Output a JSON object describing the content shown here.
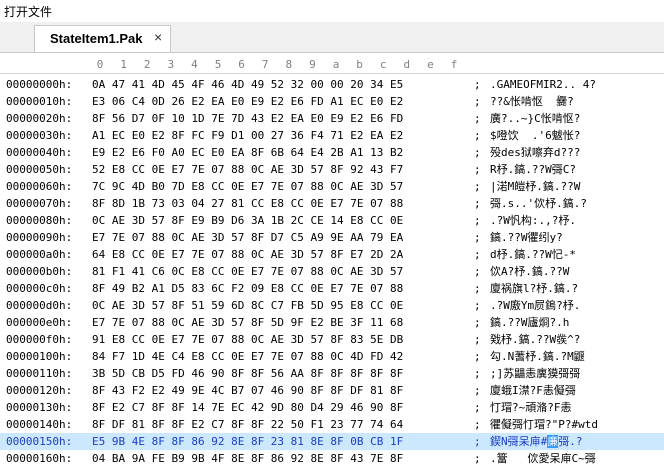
{
  "window": {
    "title": "打开文件"
  },
  "tabs": [
    {
      "label": "StateItem1.Pak",
      "close": "×"
    }
  ],
  "ruler": [
    "0",
    "1",
    "2",
    "3",
    "4",
    "5",
    "6",
    "7",
    "8",
    "9",
    "a",
    "b",
    "c",
    "d",
    "e",
    "f"
  ],
  "rows": [
    {
      "offset": "00000000h:",
      "hex": "0A 47 41 4D 45 4F 46 4D 49 52 32 00 00 20 34 E5",
      "ascii": ".GAMEOFMIR2.. 4?"
    },
    {
      "offset": "00000010h:",
      "hex": "E3 06 C4 0D 26 E2 EA E0 E9 E2 E6 FD A1 EC E0 E2",
      "ascii": "??&怅啃怄  爨?"
    },
    {
      "offset": "00000020h:",
      "hex": "8F 56 D7 0F 10 1D 7E 7D 43 E2 EA E0 E9 E2 E6 FD",
      "ascii": "廣?..~}C怅啃怄?"
    },
    {
      "offset": "00000030h:",
      "hex": "A1 EC E0 E2 8F FC F9 D1 00 27 36 F4 71 E2 EA E2",
      "ascii": "$噔饮  .'6魃怅?"
    },
    {
      "offset": "00000040h:",
      "hex": "E9 E2 E6 F0 A0 EC E0 EA 8F 6B 64 E4 2B A1 13 B2",
      "ascii": "殁des狱嚓弃d???"
    },
    {
      "offset": "00000050h:",
      "hex": "52 E8 CC 0E E7 7E 07 88 0C AE 3D 57 8F 92 43 F7",
      "ascii": "R杼.鎬.??W彁C?"
    },
    {
      "offset": "00000060h:",
      "hex": "7C 9C 4D B0 7D E8 CC 0E E7 7E 07 88 0C AE 3D 57",
      "ascii": "|渃M皚杼.鎬.??W"
    },
    {
      "offset": "00000070h:",
      "hex": "8F 8D 1B 73 03 04 27 81 CC E8 CC 0E E7 7E 07 88",
      "ascii": "彁.s..'佽杼.鎬.?"
    },
    {
      "offset": "00000080h:",
      "hex": "0C AE 3D 57 8F E9 B9 D6 3A 1B 2C CE 14 E8 CC 0E",
      "ascii": ".?W忛构:.,?杼."
    },
    {
      "offset": "00000090h:",
      "hex": "E7 7E 07 88 0C AE 3D 57 8F D7 C5 A9 9E AA 79 EA",
      "ascii": "鎬.??W忂纼y?"
    },
    {
      "offset": "000000a0h:",
      "hex": "64 E8 CC 0E E7 7E 07 88 0C AE 3D 57 8F E7 2D 2A",
      "ascii": "d杼.鎬.??W忋-*"
    },
    {
      "offset": "000000b0h:",
      "hex": "81 F1 41 C6 0C E8 CC 0E E7 7E 07 88 0C AE 3D 57",
      "ascii": "佽A?杼.鎬.??W"
    },
    {
      "offset": "000000c0h:",
      "hex": "8F 49 B2 A1 D5 83 6C F2 09 E8 CC 0E E7 7E 07 88",
      "ascii": "廈祸旗l?杼.鎬.?"
    },
    {
      "offset": "000000d0h:",
      "hex": "0C AE 3D 57 8F 51 59 6D 8C C7 FB 5D 95 E8 CC 0E",
      "ascii": ".?W廒Ym屃鎢?杼."
    },
    {
      "offset": "000000e0h:",
      "hex": "E7 7E 07 88 0C AE 3D 57 8F 5D 9F E2 BE 3F 11 68",
      "ascii": "鎬.??W廬烱?.h"
    },
    {
      "offset": "000000f0h:",
      "hex": "91 E8 CC 0E E7 7E 07 88 0C AE 3D 57 8F 83 5E DB",
      "ascii": "戣杼.鎬.??W彂^?"
    },
    {
      "offset": "00000100h:",
      "hex": "84 F7 1D 4E C4 E8 CC 0E E7 7E 07 88 0C 4D FD 42",
      "ascii": "勾.N蓍杼.鎬.?M鼴"
    },
    {
      "offset": "00000110h:",
      "hex": "3B 5D CB D5 FD 46 90 8F 8F 56 AA 8F 8F 8F 8F 8F",
      "ascii": ";]苏鼺恚廙獏彁彁"
    },
    {
      "offset": "00000120h:",
      "hex": "8F 43 F2 E2 49 9E 4C B7 07 46 90 8F 8F DF 81 8F",
      "ascii": "廈蛾I澿?F恚儗彁"
    },
    {
      "offset": "00000130h:",
      "hex": "8F E2 C7 8F 8F 14 7E EC 42 9D 80 D4 29 46 90 8F",
      "ascii": "忊瑁?~頑潃?F恚"
    },
    {
      "offset": "00000140h:",
      "hex": "8F DF 81 8F 8F E2 C7 8F 8F 22 50 F1 23 77 74 64",
      "ascii": "忂儗彁忊瑁?\"P?#wtd"
    },
    {
      "offset": "00000150h:",
      "hex": "E5 9B 4E 8F 8F 86 92 8E 8F 23 81 8E 8F 0B CB 1F",
      "ascii_a": "鍥N彁呆庘#",
      "ascii_hl": "亷",
      "ascii_b": "彁.?"
    },
    {
      "offset": "00000160h:",
      "hex": "04 BA 9A FE B9 9B 4F 8E 8F 86 92 8E 8F 43 7E 8F",
      "ascii": ".簹   佽愛呆庘C~彁"
    }
  ],
  "selection": {
    "color": "#cce8ff",
    "highlight": "#3399ff"
  }
}
